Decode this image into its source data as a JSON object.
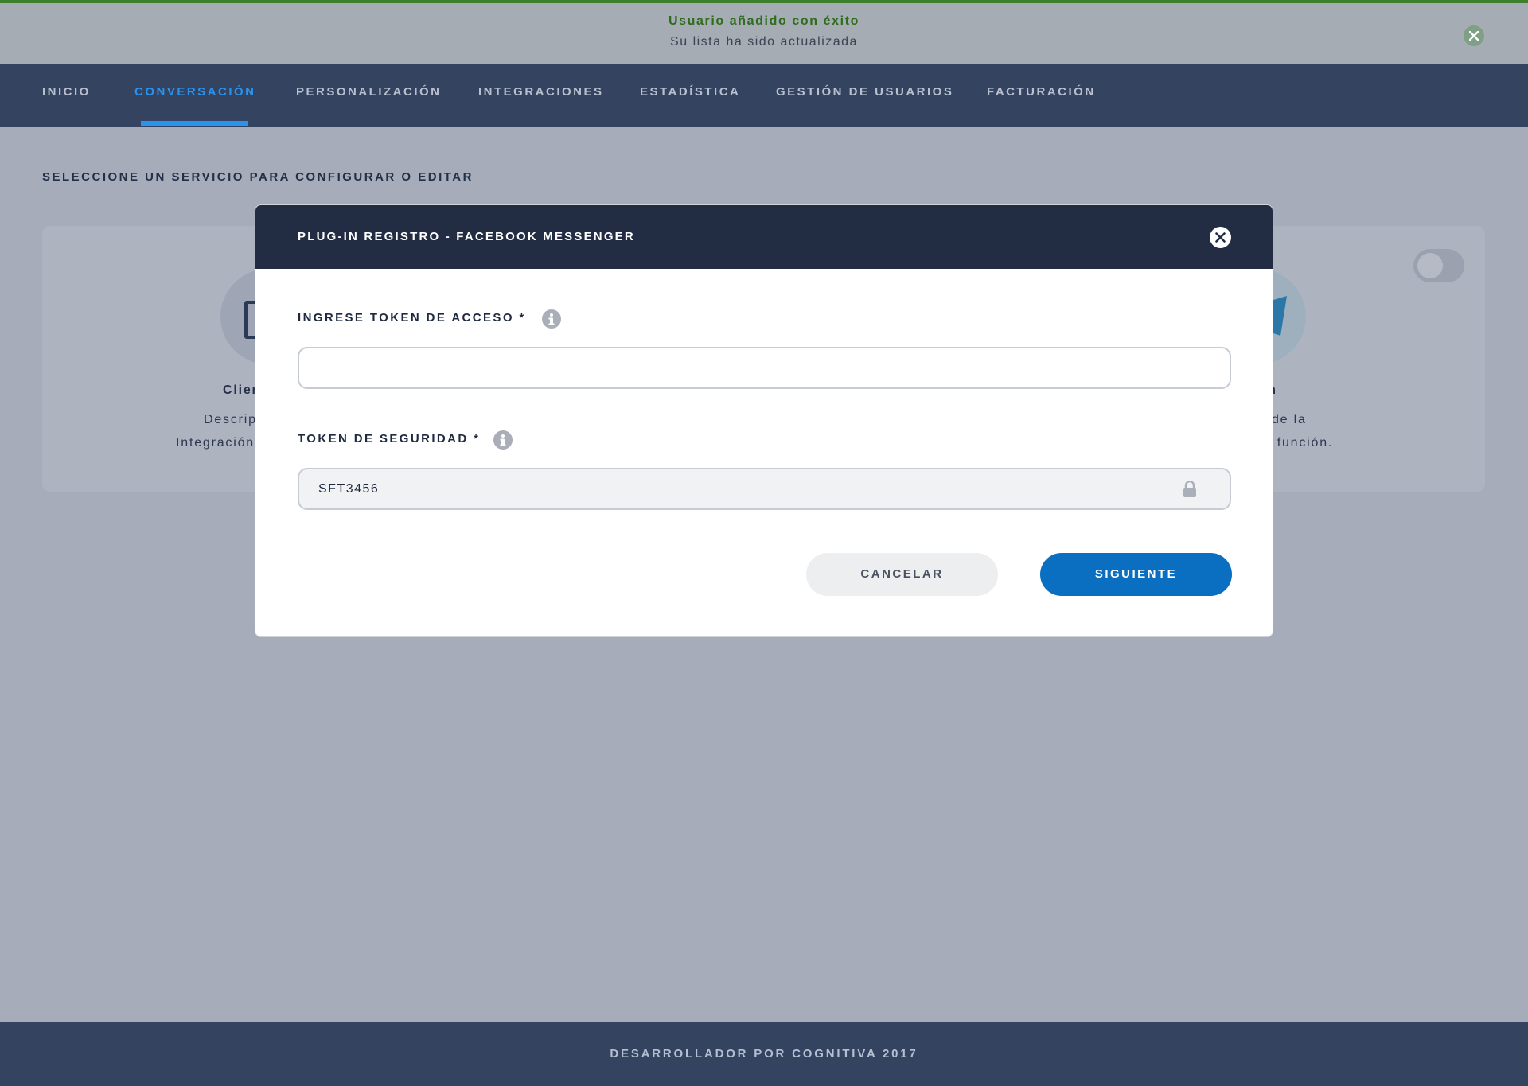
{
  "toast": {
    "title": "Usuario añadido con éxito",
    "subtitle": "Su lista ha sido actualizada",
    "close_icon": "close-icon",
    "accent_color": "#3d7f2b"
  },
  "nav": {
    "items": [
      {
        "label": "INICIO"
      },
      {
        "label": "CONVERSACIÓN",
        "active": true
      },
      {
        "label": "PERSONALIZACIÓN"
      },
      {
        "label": "INTEGRACIONES"
      },
      {
        "label": "ESTADÍSTICA"
      },
      {
        "label": "GESTIÓN DE USUARIOS"
      },
      {
        "label": "FACTURACIÓN"
      }
    ],
    "active_color": "#2b92ee"
  },
  "main": {
    "section_title": "SELECCIONE UN SERVICIO PARA CONFIGURAR O EDITAR",
    "cards": [
      {
        "title_fragment": "Clien",
        "desc_line1": "Descrip",
        "desc_line2": "Integración",
        "icon": "phone-icon"
      },
      {
        "title_fragment": "am",
        "desc_line1": "n de la",
        "desc_line2": "su función.",
        "icon": "send-icon",
        "toggle_on": false
      }
    ]
  },
  "modal": {
    "title": "PLUG-IN REGISTRO - FACEBOOK MESSENGER",
    "close_icon": "close-icon",
    "access_token": {
      "label": "INGRESE TOKEN DE ACCESO *",
      "value": "",
      "info_icon": "info-icon"
    },
    "security_token": {
      "label": "TOKEN DE SEGURIDAD *",
      "value": "SFT3456",
      "info_icon": "info-icon",
      "lock_icon": "lock-icon"
    },
    "cancel_label": "CANCELAR",
    "next_label": "SIGUIENTE",
    "primary_color": "#0a6fc0"
  },
  "footer": {
    "text": "DESARROLLADOR POR COGNITIVA 2017"
  }
}
